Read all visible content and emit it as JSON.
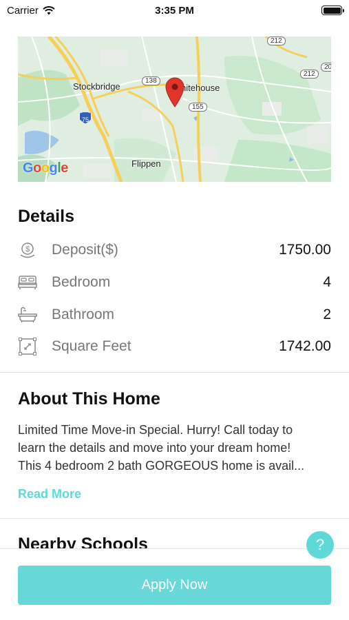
{
  "status_bar": {
    "carrier": "Carrier",
    "time": "3:35 PM"
  },
  "map": {
    "labels": {
      "stockbridge": "Stockbridge",
      "whitehouse": "hitehouse",
      "flippen": "Flippen"
    },
    "shields": {
      "s138": "138",
      "s155": "155",
      "s75": "75",
      "s212a": "212",
      "s212b": "212",
      "s20": "20"
    },
    "logo": "Google"
  },
  "details": {
    "title": "Details",
    "rows": [
      {
        "icon": "deposit-icon",
        "label": "Deposit($)",
        "value": "1750.00"
      },
      {
        "icon": "bed-icon",
        "label": "Bedroom",
        "value": "4"
      },
      {
        "icon": "bathtub-icon",
        "label": "Bathroom",
        "value": "2"
      },
      {
        "icon": "square-feet-icon",
        "label": "Square Feet",
        "value": "1742.00"
      }
    ]
  },
  "about": {
    "title": "About This Home",
    "line1": "Limited Time Move-in Special. Hurry!  Call today to",
    "line2": "learn the details and move into your dream home!",
    "line3": "This 4 bedroom 2 bath GORGEOUS home is avail...",
    "read_more": "Read More"
  },
  "schools": {
    "title": "Nearby Schools"
  },
  "help": {
    "label": "?"
  },
  "apply": {
    "label": "Apply Now"
  },
  "colors": {
    "accent": "#5fd8d8",
    "button": "#67d7d8",
    "map_bg": "#dfeee0",
    "road": "#f5cf5a",
    "pin": "#e0352b"
  }
}
